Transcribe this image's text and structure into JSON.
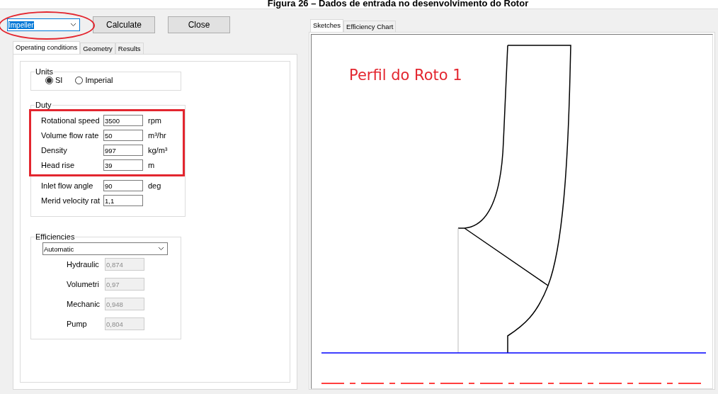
{
  "caption": "Figura 26 – Dados de entrada no desenvolvimento do Rotor",
  "toolbar": {
    "component_select": {
      "value": "Impeller",
      "highlighted": true
    },
    "buttons": [
      "Calculate",
      "Close"
    ]
  },
  "left_tabs": [
    {
      "label": "Operating conditions",
      "selected": true
    },
    {
      "label": "Geometry",
      "selected": false
    },
    {
      "label": "Results",
      "selected": false
    }
  ],
  "units": {
    "title": "Units",
    "options": [
      {
        "label": "SI",
        "selected": true
      },
      {
        "label": "Imperial",
        "selected": false
      }
    ]
  },
  "duty": {
    "title": "Duty",
    "rows": [
      {
        "label": "Rotational speed",
        "value": "3500",
        "unit": "rpm",
        "highlighted": true
      },
      {
        "label": "Volume flow rate",
        "value": "50",
        "unit": "m³/hr",
        "highlighted": true
      },
      {
        "label": "Density",
        "value": "997",
        "unit": "kg/m³",
        "highlighted": true
      },
      {
        "label": "Head rise",
        "value": "39",
        "unit": "m",
        "highlighted": true
      },
      {
        "label": "Inlet flow angle",
        "value": "90",
        "unit": "deg",
        "highlighted": false
      },
      {
        "label": "Merid velocity rat",
        "value": "1,1",
        "highlighted": false
      }
    ]
  },
  "efficiencies": {
    "title": "Efficiencies",
    "mode": "Automatic",
    "rows": [
      {
        "label": "Hydraulic",
        "value": "0,874",
        "disabled": true
      },
      {
        "label": "Volumetri",
        "value": "0,97",
        "disabled": true
      },
      {
        "label": "Mechanic",
        "value": "0,948",
        "disabled": true
      },
      {
        "label": "Pump",
        "value": "0,804",
        "disabled": true
      }
    ]
  },
  "right_tabs": [
    {
      "label": "Sketches",
      "selected": true
    },
    {
      "label": "Efficiency Chart",
      "selected": false
    }
  ],
  "sketch": {
    "label": "Perfil do Roto 1"
  }
}
